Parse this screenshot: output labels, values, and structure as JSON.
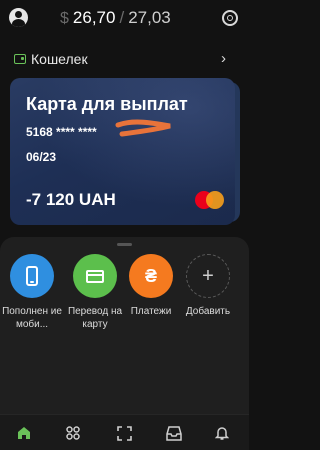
{
  "header": {
    "currency_symbol": "$",
    "rate_buy": "26,70",
    "separator": "/",
    "rate_sell": "27,03"
  },
  "wallet": {
    "label": "Кошелек"
  },
  "card": {
    "title": "Карта для выплат",
    "number": "5168 **** ****",
    "expiry": "06/23",
    "balance": "-7 120 UAH",
    "payment_system_icon": "mastercard-logo-icon"
  },
  "actions": [
    {
      "label": "Пополнен ие моби...",
      "color": "#2f8fe0",
      "icon": "phone-icon"
    },
    {
      "label": "Перевод на карту",
      "color": "#5cbf4c",
      "icon": "card-icon"
    },
    {
      "label": "Платежи",
      "color": "#f57a1f",
      "icon": "hryvnia-icon"
    },
    {
      "label": "Добавить",
      "color": "#1f1f1f",
      "icon": "plus-icon"
    }
  ],
  "bottom_nav": [
    {
      "icon": "home-icon",
      "active": true,
      "color": "#6ac259"
    },
    {
      "icon": "grid-icon",
      "active": false
    },
    {
      "icon": "scan-icon",
      "active": false
    },
    {
      "icon": "inbox-icon",
      "active": false
    },
    {
      "icon": "bell-icon",
      "active": false
    }
  ],
  "colors": {
    "accent": "#6ac259",
    "background": "#121212",
    "sheet": "#1f1f1f",
    "card": "#1e2f55"
  }
}
